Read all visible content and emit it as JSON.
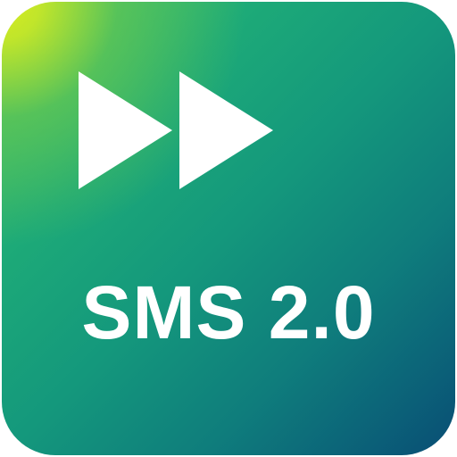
{
  "app_icon": {
    "label": "SMS 2.0",
    "icon": "fast-forward-icon",
    "colors": {
      "gradient_top_left": "#d8ec1f",
      "gradient_mid": "#14987c",
      "gradient_bottom_right": "#094d74",
      "foreground": "#ffffff"
    }
  }
}
